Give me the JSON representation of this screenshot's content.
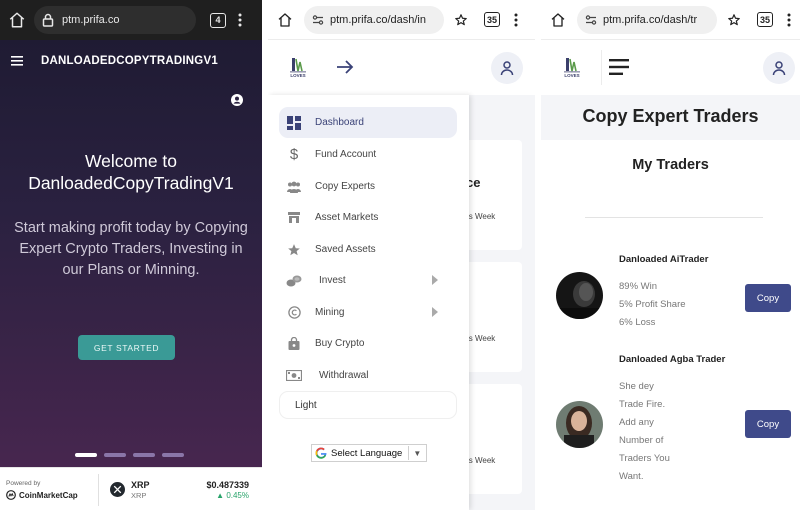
{
  "panel1": {
    "browser": {
      "url": "ptm.prifa.co",
      "tab_count": "4"
    },
    "brand": "DANLOADEDCOPYTRADINGV1",
    "hero": {
      "welcome": "Welcome to",
      "site_name": "DanloadedCopyTradingV1",
      "subtitle": "Start making profit today by Copying Expert Crypto Traders, Investing in our Plans or Minning.",
      "cta": "GET STARTED"
    },
    "ticker": {
      "powered_by": "Powered by",
      "provider": "CoinMarketCap",
      "symbol": "XRP",
      "name": "XRP",
      "price": "$0.487339",
      "change": "0.45%",
      "change_color": "#28a36a"
    }
  },
  "panel2": {
    "browser": {
      "url": "ptm.prifa.co/dash/in",
      "tab_count": "35"
    },
    "logo_text": "LOVES",
    "menu": [
      {
        "label": "Dashboard",
        "icon": "dashboard-icon",
        "active": true
      },
      {
        "label": "Fund Account",
        "icon": "dollar-icon"
      },
      {
        "label": "Copy Experts",
        "icon": "users-icon"
      },
      {
        "label": "Asset Markets",
        "icon": "store-icon"
      },
      {
        "label": "Saved Assets",
        "icon": "star-icon"
      },
      {
        "label": "Invest",
        "icon": "coins-icon",
        "has_submenu": true
      },
      {
        "label": "Mining",
        "icon": "copyright-icon",
        "has_submenu": true
      },
      {
        "label": "Buy Crypto",
        "icon": "bag-icon"
      },
      {
        "label": "Withdrawal",
        "icon": "money-icon"
      }
    ],
    "theme_label": "Light",
    "language_label": "Select Language",
    "background": {
      "peek_ce": "ce",
      "peek_week": "is Week"
    }
  },
  "panel3": {
    "browser": {
      "url": "ptm.prifa.co/dash/tr",
      "tab_count": "35"
    },
    "logo_text": "LOVES",
    "title": "Copy Expert Traders",
    "section": "My Traders",
    "traders": [
      {
        "name": "Danloaded AiTrader",
        "lines": [
          "89% Win",
          "5% Profit Share",
          "6% Loss"
        ],
        "button": "Copy"
      },
      {
        "name": "Danloaded Agba Trader",
        "lines": [
          "She dey",
          "Trade Fire.",
          "Add any",
          "Number of",
          "Traders You",
          "Want."
        ],
        "button": "Copy"
      }
    ]
  },
  "colors": {
    "accent_teal": "#3a9a96",
    "copy_button": "#3f4a8a",
    "hero_top": "#1f1b33",
    "hero_bottom": "#47264f"
  }
}
